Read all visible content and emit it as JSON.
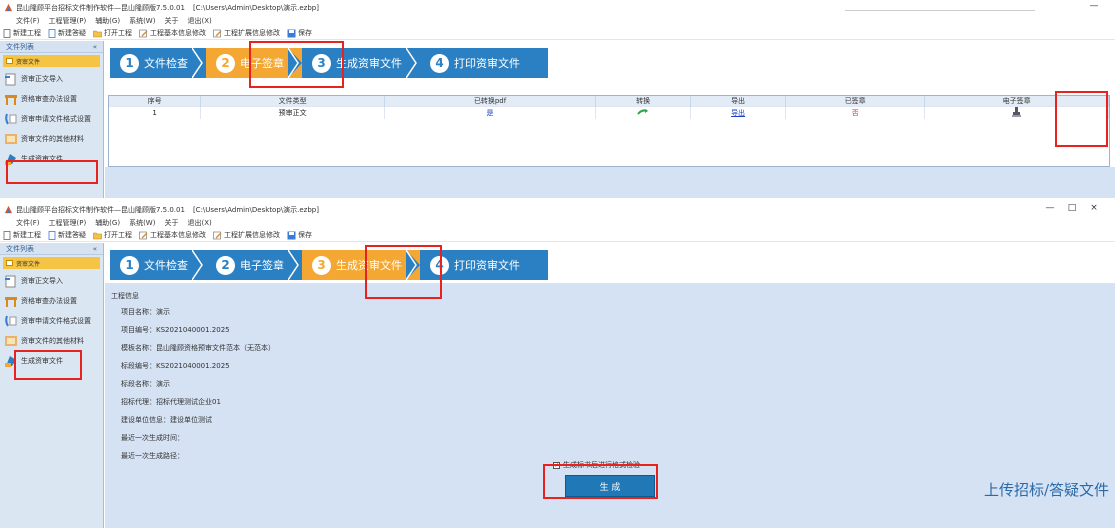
{
  "w1": {
    "title": "昆山隆顾平台招标文件制作软件—昆山隆顾版7.5.0.01",
    "path": "[C:\\Users\\Admin\\Desktop\\演示.ezbp]",
    "win_min": "—",
    "menu": [
      "文件(F)",
      "工程管理(P)",
      "辅助(G)",
      "系统(W)",
      "关于",
      "退出(X)"
    ],
    "toolbar": [
      "新建工程",
      "新建答疑",
      "打开工程",
      "工程基本信息修改",
      "工程扩展信息修改",
      "保存"
    ],
    "sidebar": {
      "header": "文件列表",
      "collapse": "«",
      "active": "资审文件",
      "items": [
        "资审正文导入",
        "资格审查办法设置",
        "资审申请文件格式设置",
        "资审文件的其他材料",
        "生成资审文件"
      ]
    },
    "steps": [
      {
        "num": "1",
        "label": "文件检查"
      },
      {
        "num": "2",
        "label": "电子签章"
      },
      {
        "num": "3",
        "label": "生成资审文件"
      },
      {
        "num": "4",
        "label": "打印资审文件"
      }
    ],
    "active_step": 1,
    "table": {
      "headers": [
        "序号",
        "文件类型",
        "已转换pdf",
        "转换",
        "导出",
        "已签章",
        "电子签章"
      ],
      "rows": [
        {
          "no": "1",
          "type": "预审正文",
          "converted": "是",
          "export": "导出",
          "signed": "否"
        }
      ]
    }
  },
  "w2": {
    "title": "昆山隆顾平台招标文件制作软件—昆山隆顾版7.5.0.01",
    "path": "[C:\\Users\\Admin\\Desktop\\演示.ezbp]",
    "win_min": "—",
    "win_max": "□",
    "win_close": "×",
    "menu": [
      "文件(F)",
      "工程管理(P)",
      "辅助(G)",
      "系统(W)",
      "关于",
      "退出(X)"
    ],
    "toolbar": [
      "新建工程",
      "新建答疑",
      "打开工程",
      "工程基本信息修改",
      "工程扩展信息修改",
      "保存"
    ],
    "sidebar": {
      "header": "文件列表",
      "collapse": "«",
      "active": "资审文件",
      "items": [
        "资审正文导入",
        "资格审查办法设置",
        "资审申请文件格式设置",
        "资审文件的其他材料",
        "生成资审文件"
      ]
    },
    "steps": [
      {
        "num": "1",
        "label": "文件检查"
      },
      {
        "num": "2",
        "label": "电子签章"
      },
      {
        "num": "3",
        "label": "生成资审文件"
      },
      {
        "num": "4",
        "label": "打印资审文件"
      }
    ],
    "active_step": 2,
    "info_header": "工程信息",
    "info": [
      "项目名称：演示",
      "项目编号：KS2021040001.2025",
      "模板名称：昆山隆顾资格预审文件范本（无范本）",
      "标段编号：KS2021040001.2025",
      "标段名称：演示",
      "招标代理：招标代理测试企业01",
      "建设单位信息：建设单位测试",
      "最近一次生成时间：",
      "最近一次生成路径："
    ],
    "checkbox_label": "生成标书后进行格式检验",
    "checkbox_mark": "✓",
    "generate_button": "生  成",
    "upload_link": "上传招标/答疑文件"
  },
  "colors": {
    "accent": "#2b80c3",
    "active_step": "#f4a732",
    "highlight": "#e8231f",
    "panel": "#d4e2f3"
  }
}
